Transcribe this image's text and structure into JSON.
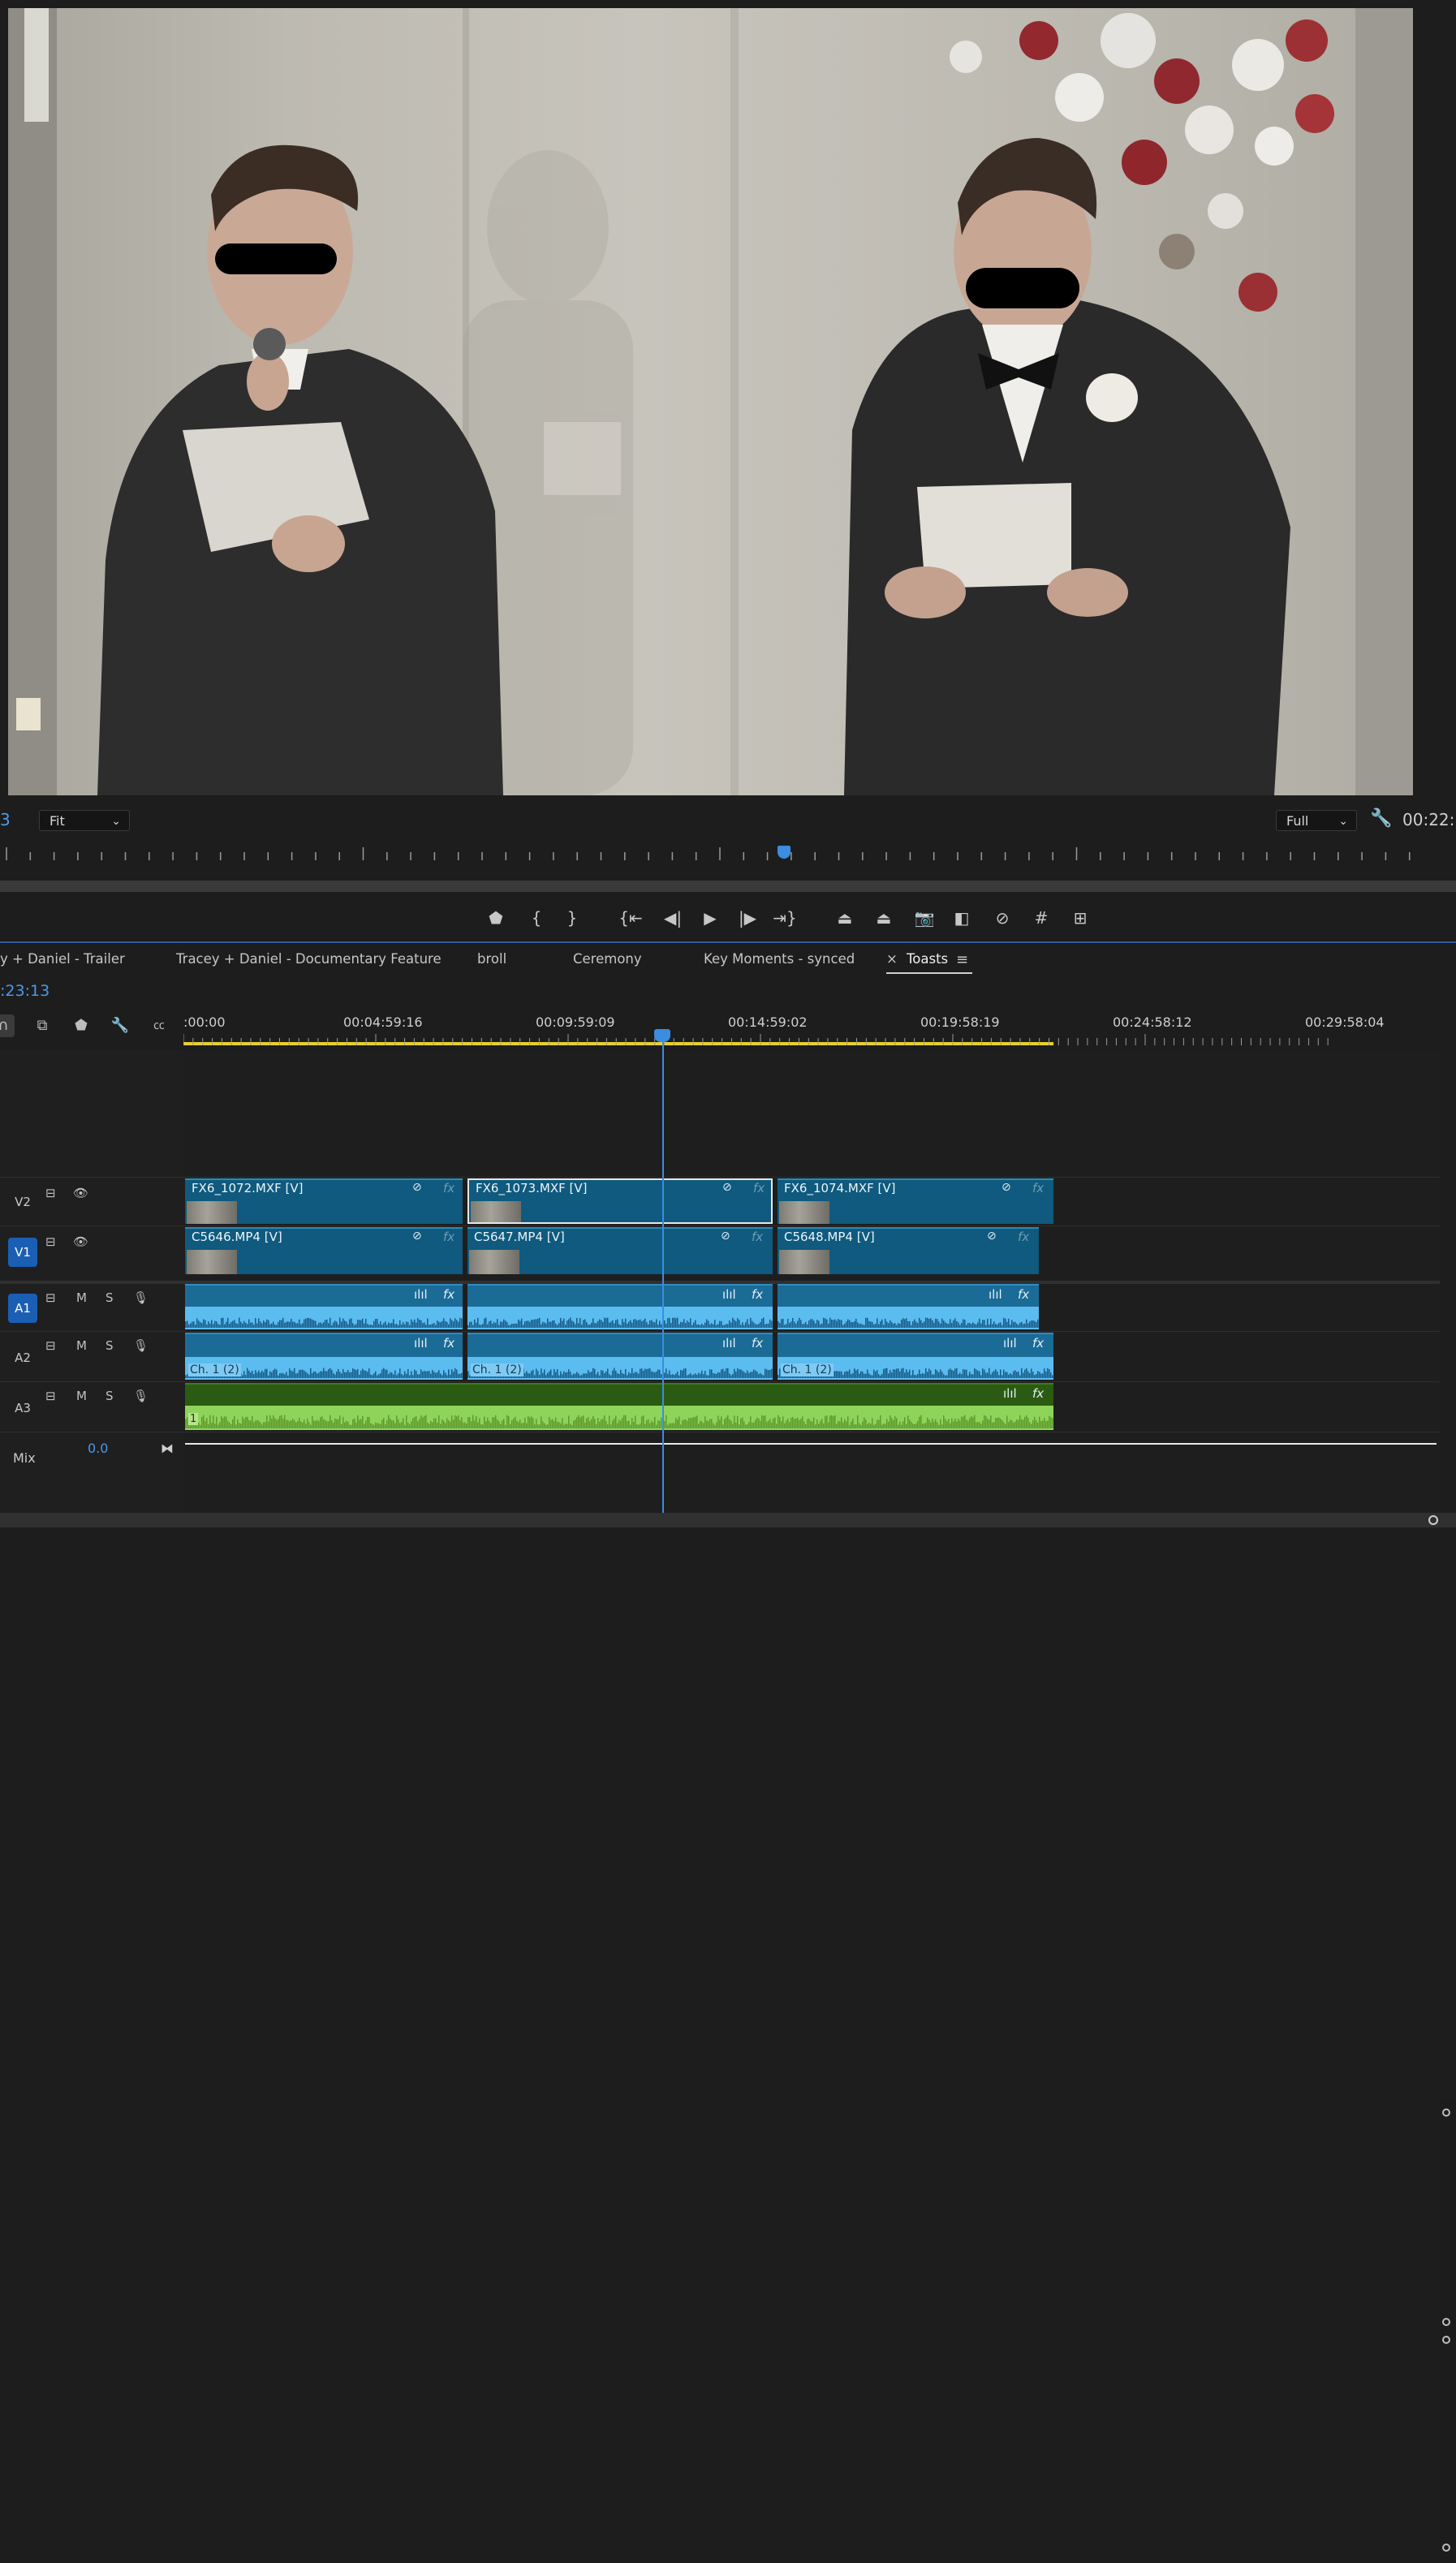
{
  "monitor": {
    "left_timecode": "3",
    "zoom_select": "Fit",
    "quality_select": "Full",
    "right_timecode": "00:22:"
  },
  "transport": {
    "buttons": [
      {
        "icon": "marker-icon",
        "glyph": "⬟"
      },
      {
        "icon": "mark-in-icon",
        "glyph": "{"
      },
      {
        "icon": "mark-out-icon",
        "glyph": "}"
      },
      {
        "icon": "go-to-in-icon",
        "glyph": "{⇤"
      },
      {
        "icon": "step-back-icon",
        "glyph": "◀|"
      },
      {
        "icon": "play-icon",
        "glyph": "▶"
      },
      {
        "icon": "step-forward-icon",
        "glyph": "|▶"
      },
      {
        "icon": "go-to-out-icon",
        "glyph": "⇥}"
      },
      {
        "icon": "lift-icon",
        "glyph": "⏏"
      },
      {
        "icon": "extract-icon",
        "glyph": "⏏"
      },
      {
        "icon": "export-frame-icon",
        "glyph": "📷"
      },
      {
        "icon": "comparison-view-icon",
        "glyph": "◧"
      },
      {
        "icon": "proxy-toggle-icon",
        "glyph": "⊘"
      },
      {
        "icon": "safe-margins-icon",
        "glyph": "#"
      },
      {
        "icon": "multicam-icon",
        "glyph": "⊞"
      }
    ]
  },
  "timeline": {
    "tabs": [
      {
        "label": "y + Daniel - Trailer"
      },
      {
        "label": "Tracey + Daniel - Documentary Feature"
      },
      {
        "label": "broll"
      },
      {
        "label": "Ceremony"
      },
      {
        "label": "Key Moments - synced"
      },
      {
        "label": "Toasts",
        "active": true
      }
    ],
    "close_glyph": "×",
    "menu_glyph": "≡",
    "timecode": ":23:13",
    "ruler_labels": [
      ":00:00",
      "00:04:59:16",
      "00:09:59:09",
      "00:14:59:02",
      "00:19:58:19",
      "00:24:58:12",
      "00:29:58:04"
    ],
    "tracks": {
      "v2": {
        "name": "V2"
      },
      "v1": {
        "name": "V1"
      },
      "a1": {
        "name": "A1",
        "mute": "M",
        "solo": "S"
      },
      "a2": {
        "name": "A2",
        "mute": "M",
        "solo": "S"
      },
      "a3": {
        "name": "A3",
        "mute": "M",
        "solo": "S"
      },
      "mix": {
        "name": "Mix",
        "value": "0.0"
      }
    },
    "v2_clips": [
      "FX6_1072.MXF [V]",
      "FX6_1073.MXF [V]",
      "FX6_1074.MXF [V]"
    ],
    "v1_clips": [
      "C5646.MP4 [V]",
      "C5647.MP4 [V]",
      "C5648.MP4 [V]"
    ],
    "a2_channel_label": "Ch. 1 (2)",
    "a3_channel_label": "1",
    "fx_label": "fx",
    "audio_icon": "ılıl"
  },
  "colors": {
    "accent": "#3a8de0",
    "video_clip": "#0f5a7e",
    "audio_clip": "#1b6b97",
    "audio_wave": "#5bbcf0",
    "music_clip": "#2b5b12",
    "music_wave": "#8fd45a",
    "work_area": "#e6d12e"
  }
}
